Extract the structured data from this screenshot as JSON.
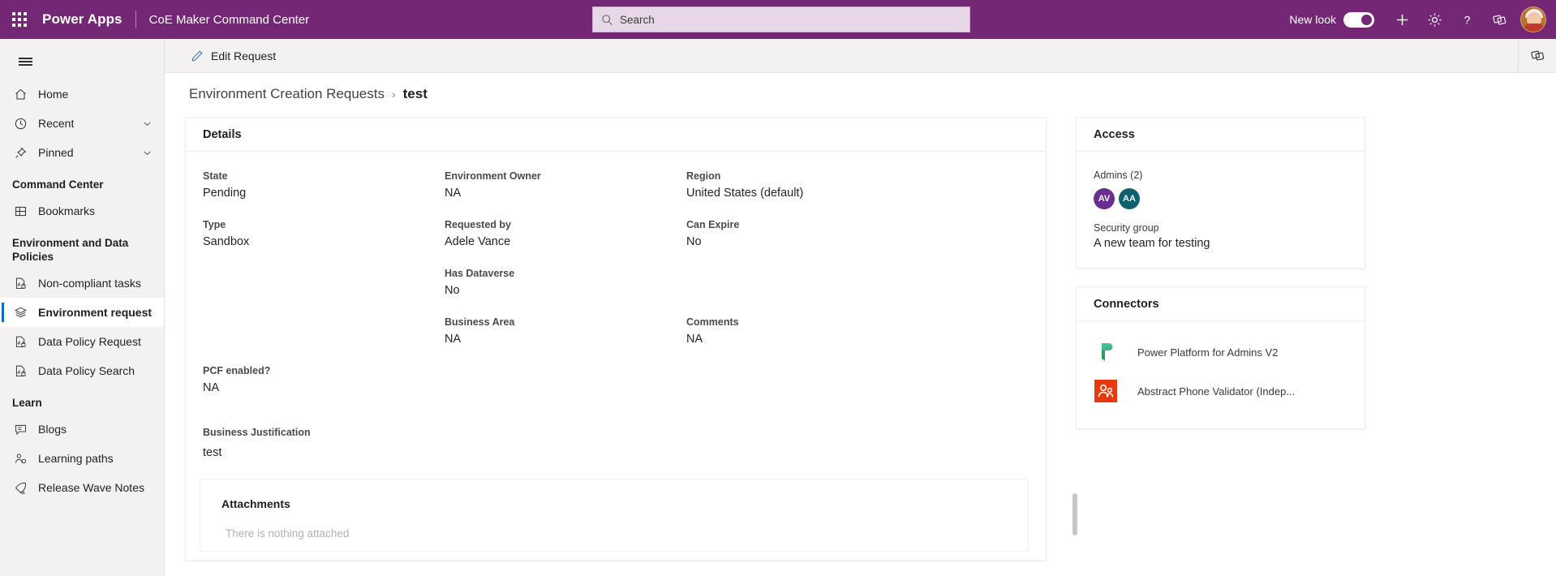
{
  "header": {
    "waffle_name": "app-launcher",
    "brand": "Power Apps",
    "app_name": "CoE Maker Command Center",
    "search_placeholder": "Search",
    "search_value": "",
    "new_look_label": "New look",
    "new_look_on": true,
    "icons": [
      "plus-icon",
      "gear-icon",
      "help-icon",
      "feedback-icon"
    ],
    "brand_color": "#742774"
  },
  "sidebar": {
    "hamburger_name": "site-map-toggle",
    "items": [
      {
        "label": "Home",
        "icon": "home-icon",
        "chevron": false,
        "selected": false
      },
      {
        "label": "Recent",
        "icon": "clock-icon",
        "chevron": true,
        "selected": false
      },
      {
        "label": "Pinned",
        "icon": "pin-icon",
        "chevron": true,
        "selected": false
      }
    ],
    "groups": [
      {
        "title": "Command Center",
        "items": [
          {
            "label": "Bookmarks",
            "icon": "bookmark-grid-icon",
            "selected": false
          }
        ]
      },
      {
        "title": "Environment and Data Policies",
        "items": [
          {
            "label": "Non-compliant tasks",
            "icon": "report-lock-icon",
            "selected": false
          },
          {
            "label": "Environment request",
            "icon": "layers-icon",
            "selected": true
          },
          {
            "label": "Data Policy Request",
            "icon": "report-lock-icon",
            "selected": false
          },
          {
            "label": "Data Policy Search",
            "icon": "report-lock-icon",
            "selected": false
          }
        ]
      },
      {
        "title": "Learn",
        "items": [
          {
            "label": "Blogs",
            "icon": "blog-icon",
            "selected": false
          },
          {
            "label": "Learning paths",
            "icon": "person-path-icon",
            "selected": false
          },
          {
            "label": "Release Wave Notes",
            "icon": "release-notes-icon",
            "selected": false
          }
        ]
      }
    ],
    "selection_color": "#0f6cbd"
  },
  "command_bar": {
    "edit_label": "Edit Request",
    "edit_icon": "pencil-icon",
    "right_icon": "feedback-cards-icon"
  },
  "breadcrumb": {
    "parent": "Environment Creation Requests",
    "separator": "›",
    "current": "test"
  },
  "details": {
    "title": "Details",
    "fields": [
      {
        "label": "State",
        "value": "Pending",
        "col": 1,
        "row": 1
      },
      {
        "label": "Environment Owner",
        "value": "NA",
        "col": 2,
        "row": 1
      },
      {
        "label": "Region",
        "value": "United States (default)",
        "col": 3,
        "row": 1
      },
      {
        "label": "Type",
        "value": "Sandbox",
        "col": 1,
        "row": 2
      },
      {
        "label": "Requested by",
        "value": "Adele Vance",
        "col": 2,
        "row": 2
      },
      {
        "label": "Can Expire",
        "value": "No",
        "col": 3,
        "row": 2
      },
      {
        "label": "Has Dataverse",
        "value": "No",
        "col": 2,
        "row": 3
      },
      {
        "label": "Business Area",
        "value": "NA",
        "col": 2,
        "row": 4
      },
      {
        "label": "Comments",
        "value": "NA",
        "col": 3,
        "row": 4
      },
      {
        "label": "PCF enabled?",
        "value": "NA",
        "col": 1,
        "row": 5
      }
    ],
    "justification_label": "Business Justification",
    "justification_value": "test",
    "attachments_title": "Attachments",
    "attachments_empty": "There is nothing attached"
  },
  "access": {
    "title": "Access",
    "admins_label": "Admins (2)",
    "admins": [
      {
        "initials": "AV",
        "color": "#6b2d90"
      },
      {
        "initials": "AA",
        "color": "#10606f"
      }
    ],
    "security_group_label": "Security group",
    "security_group_value": "A new team for testing"
  },
  "connectors": {
    "title": "Connectors",
    "items": [
      {
        "name": "Power Platform for Admins V2",
        "icon": "power-platform-icon"
      },
      {
        "name": "Abstract Phone Validator (Indep...",
        "icon": "abstract-phone-validator-icon"
      }
    ]
  }
}
